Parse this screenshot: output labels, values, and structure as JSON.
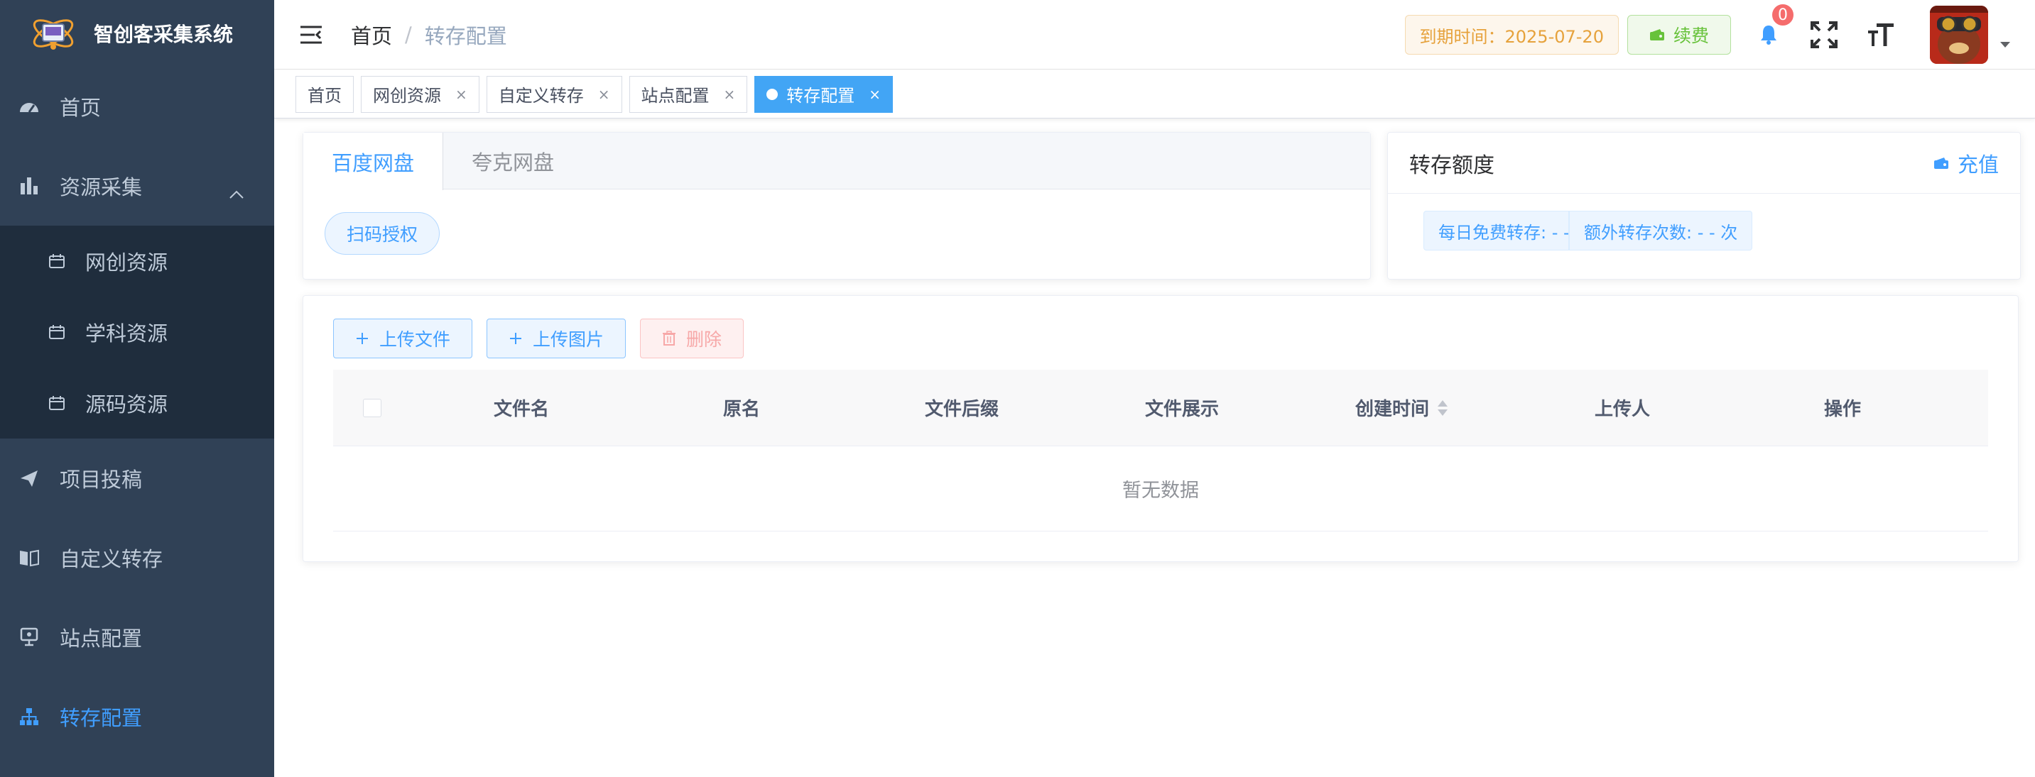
{
  "app": {
    "title": "智创客采集系统"
  },
  "sidebar": {
    "items": [
      {
        "label": "首页",
        "icon": "dashboard-icon"
      },
      {
        "label": "资源采集",
        "icon": "bar-chart-icon",
        "expanded": true,
        "children": [
          {
            "label": "网创资源",
            "icon": "calendar-icon"
          },
          {
            "label": "学科资源",
            "icon": "calendar-icon"
          },
          {
            "label": "源码资源",
            "icon": "calendar-icon"
          }
        ]
      },
      {
        "label": "项目投稿",
        "icon": "paper-plane-icon"
      },
      {
        "label": "自定义转存",
        "icon": "book-icon"
      },
      {
        "label": "站点配置",
        "icon": "monitor-icon"
      },
      {
        "label": "转存配置",
        "icon": "tree-icon",
        "active": true
      }
    ]
  },
  "header": {
    "breadcrumb": {
      "home": "首页",
      "separator": "/",
      "current": "转存配置"
    },
    "expire_text": "到期时间：2025-07-20",
    "renew_label": "续费",
    "notification_count": "0"
  },
  "tags": [
    {
      "label": "首页",
      "closable": false
    },
    {
      "label": "网创资源",
      "closable": true
    },
    {
      "label": "自定义转存",
      "closable": true
    },
    {
      "label": "站点配置",
      "closable": true
    },
    {
      "label": "转存配置",
      "closable": true,
      "active": true
    }
  ],
  "tag_close": "×",
  "pan": {
    "tabs": [
      "百度网盘",
      "夸克网盘"
    ],
    "scan_button": "扫码授权"
  },
  "quota": {
    "title": "转存额度",
    "recharge_label": "充值",
    "daily_free": "每日免费转存: - - 次",
    "extra": "额外转存次数: - - 次"
  },
  "toolbar": {
    "upload_file": "上传文件",
    "upload_image": "上传图片",
    "delete": "删除"
  },
  "table": {
    "columns": [
      "文件名",
      "原名",
      "文件后缀",
      "文件展示",
      "创建时间",
      "上传人",
      "操作"
    ],
    "empty_text": "暂无数据"
  },
  "colors": {
    "sidebar_bg": "#304156",
    "submenu_bg": "#1f2d3d",
    "accent": "#409eff",
    "active_tag": "#42a5f5",
    "warning": "#e6a23c",
    "success": "#67c23a",
    "danger": "#f56c6c"
  }
}
